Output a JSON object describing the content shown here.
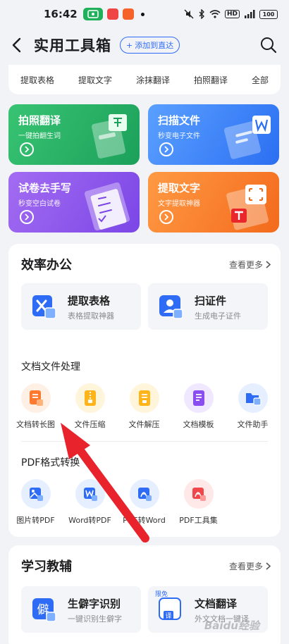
{
  "status_bar": {
    "time": "16:42",
    "battery": "100",
    "hd_label": "HD"
  },
  "header": {
    "title": "实用工具箱",
    "add_direct_label": "添加到直达"
  },
  "tabs": [
    "提取表格",
    "提取文字",
    "涂抹翻译",
    "拍照翻译",
    "全部"
  ],
  "features": [
    {
      "title": "拍照翻译",
      "subtitle": "一键拍翻生词"
    },
    {
      "title": "扫描文件",
      "subtitle": "秒变电子文件"
    },
    {
      "title": "试卷去手写",
      "subtitle": "秒变空白试卷"
    },
    {
      "title": "提取文字",
      "subtitle": "文字提取神器"
    }
  ],
  "office": {
    "title": "效率办公",
    "more": "查看更多",
    "cards": [
      {
        "name": "提取表格",
        "desc": "表格提取神器"
      },
      {
        "name": "扫证件",
        "desc": "生成电子证件"
      }
    ],
    "doc_section_title": "文档文件处理",
    "doc_tools": [
      "文档转长图",
      "文件压缩",
      "文件解压",
      "文档模板",
      "文件助手"
    ],
    "pdf_section_title": "PDF格式转换",
    "pdf_tools": [
      "图片转PDF",
      "Word转PDF",
      "PDF转Word",
      "PDF工具集"
    ]
  },
  "study": {
    "title": "学习教辅",
    "more": "查看更多",
    "cards": [
      {
        "name": "生僻字识别",
        "desc": "一键识别生僻字"
      },
      {
        "name": "文档翻译",
        "desc": "外文文档一键译",
        "badge": "限免"
      }
    ]
  },
  "watermark": "Baidu经验",
  "colors": {
    "accent": "#2f6cf6",
    "annotation_arrow": "#e8232c"
  }
}
